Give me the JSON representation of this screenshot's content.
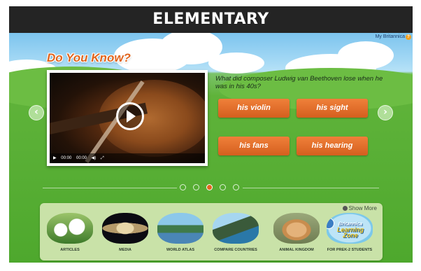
{
  "header": {
    "title": "ELEMENTARY"
  },
  "top_link": {
    "label": "My Britannica",
    "help_glyph": "?"
  },
  "quiz": {
    "heading": "Do You Know?",
    "question": "What did composer Ludwig van Beethoven lose when he was in his 40s?",
    "answers": [
      "his violin",
      "his sight",
      "his fans",
      "his hearing"
    ],
    "video_controls": {
      "time_elapsed": "00:00",
      "time_total": "00:00"
    }
  },
  "carousel": {
    "prev_glyph": "‹",
    "next_glyph": "›",
    "page_count": 5,
    "active_page": 3
  },
  "categories": {
    "show_more_label": "Show More",
    "items": [
      {
        "label": "ARTICLES",
        "icon": "flowers-image"
      },
      {
        "label": "MEDIA",
        "icon": "saturn-image"
      },
      {
        "label": "WORLD ATLAS",
        "icon": "landscape-image"
      },
      {
        "label": "COMPARE COUNTRIES",
        "icon": "mountains-image"
      },
      {
        "label": "ANIMAL KINGDOM",
        "icon": "lion-image"
      },
      {
        "label": "FOR PREK-2 STUDENTS",
        "icon": "learning-zone-logo",
        "logo_text": "Britannica Learning Zone"
      }
    ]
  },
  "colors": {
    "header_bg": "#242424",
    "accent_orange": "#e0641d",
    "grass": "#5fb33a",
    "sky": "#9fd6f4"
  }
}
